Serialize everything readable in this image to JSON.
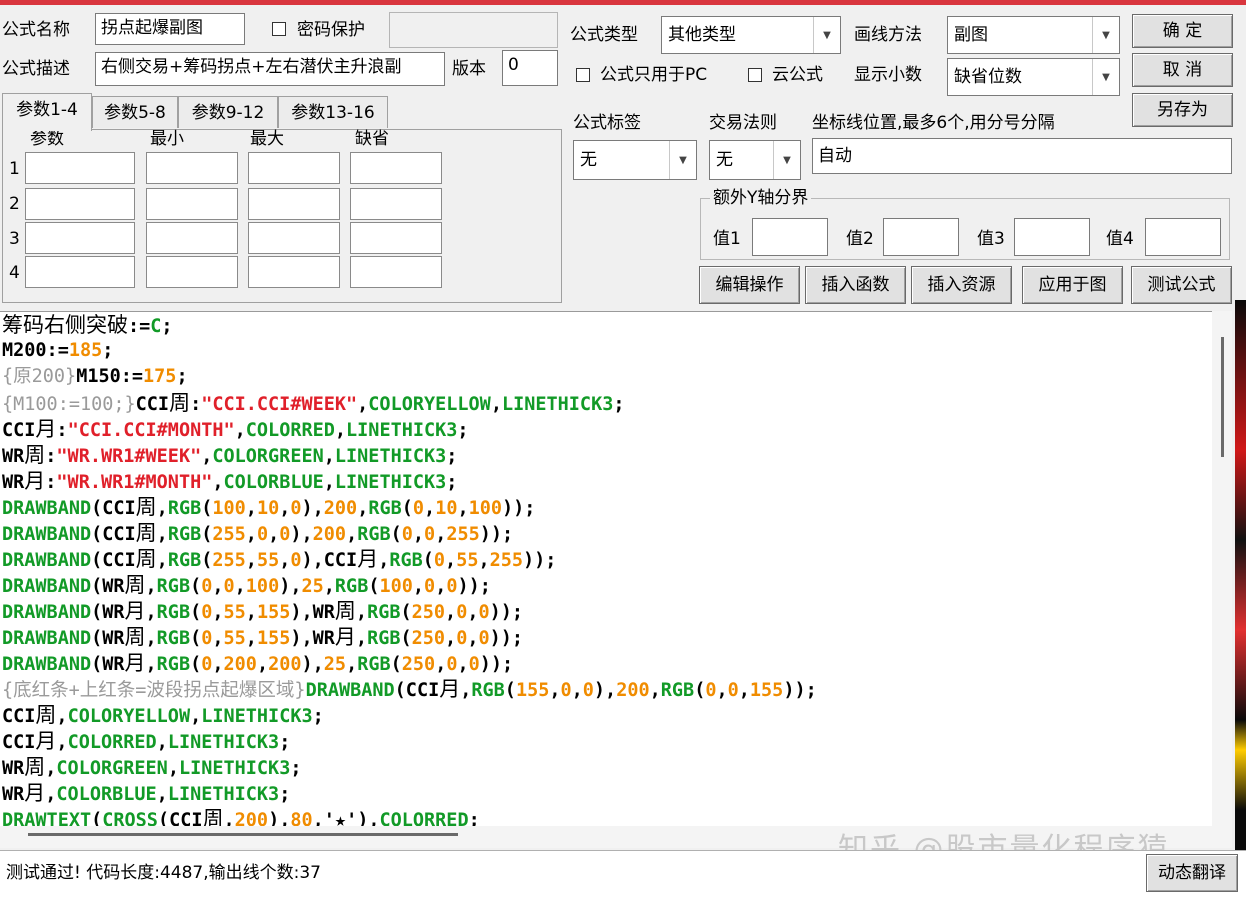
{
  "window": {
    "top_bar_color": "#d9363e"
  },
  "form": {
    "name_label": "公式名称",
    "name_value": "拐点起爆副图",
    "password_label": "密码保护",
    "desc_label": "公式描述",
    "desc_value": "右侧交易+筹码拐点+左右潜伏主升浪副",
    "version_label": "版本",
    "version_value": "0",
    "type_label": "公式类型",
    "type_value": "其他类型",
    "draw_label": "画线方法",
    "draw_value": "副图",
    "pc_only_label": "公式只用于PC",
    "cloud_label": "云公式",
    "decimals_label": "显示小数",
    "decimals_value": "缺省位数",
    "tag_label": "公式标签",
    "tag_value": "无",
    "rule_label": "交易法则",
    "rule_value": "无",
    "coord_label": "坐标线位置,最多6个,用分号分隔",
    "coord_value": "自动",
    "yaxis_group_label": "额外Y轴分界",
    "yaxis_values": [
      "值1",
      "值2",
      "值3",
      "值4"
    ]
  },
  "buttons": {
    "ok": "确  定",
    "cancel": "取  消",
    "save_as": "另存为",
    "edit": "编辑操作",
    "insert_func": "插入函数",
    "insert_res": "插入资源",
    "apply": "应用于图",
    "test": "测试公式",
    "dyn_translate": "动态翻译"
  },
  "params": {
    "tabs": [
      "参数1-4",
      "参数5-8",
      "参数9-12",
      "参数13-16"
    ],
    "headers": [
      "参数",
      "最小",
      "最大",
      "缺省"
    ],
    "rows": [
      "1",
      "2",
      "3",
      "4"
    ]
  },
  "code_lines": [
    [
      [
        "cn",
        "筹码右侧突破"
      ],
      [
        "k",
        ":="
      ],
      [
        "g",
        "C"
      ],
      [
        "k",
        ";"
      ]
    ],
    [
      [
        "k",
        "M200:="
      ],
      [
        "o",
        "185"
      ],
      [
        "k",
        ";"
      ]
    ],
    [
      [
        "gr",
        "{原200}"
      ],
      [
        "k",
        "M150:="
      ],
      [
        "o",
        "175"
      ],
      [
        "k",
        ";"
      ]
    ],
    [
      [
        "gr",
        "{M100:=100;}"
      ],
      [
        "k",
        "CCI"
      ],
      [
        "cnk",
        "周"
      ],
      [
        "k",
        ":"
      ],
      [
        "r",
        "\"CCI.CCI#WEEK\""
      ],
      [
        "k",
        ","
      ],
      [
        "g",
        "COLORYELLOW"
      ],
      [
        "k",
        ","
      ],
      [
        "g",
        "LINETHICK3"
      ],
      [
        "k",
        ";"
      ]
    ],
    [
      [
        "k",
        "CCI"
      ],
      [
        "cnk",
        "月"
      ],
      [
        "k",
        ":"
      ],
      [
        "r",
        "\"CCI.CCI#MONTH\""
      ],
      [
        "k",
        ","
      ],
      [
        "g",
        "COLORRED"
      ],
      [
        "k",
        ","
      ],
      [
        "g",
        "LINETHICK3"
      ],
      [
        "k",
        ";"
      ]
    ],
    [
      [
        "k",
        "WR"
      ],
      [
        "cnk",
        "周"
      ],
      [
        "k",
        ":"
      ],
      [
        "r",
        "\"WR.WR1#WEEK\""
      ],
      [
        "k",
        ","
      ],
      [
        "g",
        "COLORGREEN"
      ],
      [
        "k",
        ","
      ],
      [
        "g",
        "LINETHICK3"
      ],
      [
        "k",
        ";"
      ]
    ],
    [
      [
        "k",
        "WR"
      ],
      [
        "cnk",
        "月"
      ],
      [
        "k",
        ":"
      ],
      [
        "r",
        "\"WR.WR1#MONTH\""
      ],
      [
        "k",
        ","
      ],
      [
        "g",
        "COLORBLUE"
      ],
      [
        "k",
        ","
      ],
      [
        "g",
        "LINETHICK3"
      ],
      [
        "k",
        ";"
      ]
    ],
    [
      [
        "g",
        "DRAWBAND"
      ],
      [
        "k",
        "(CCI"
      ],
      [
        "cnk",
        "周"
      ],
      [
        "k",
        ","
      ],
      [
        "g",
        "RGB"
      ],
      [
        "k",
        "("
      ],
      [
        "o",
        "100"
      ],
      [
        "k",
        ","
      ],
      [
        "o",
        "10"
      ],
      [
        "k",
        ","
      ],
      [
        "o",
        "0"
      ],
      [
        "k",
        "),"
      ],
      [
        "o",
        "200"
      ],
      [
        "k",
        ","
      ],
      [
        "g",
        "RGB"
      ],
      [
        "k",
        "("
      ],
      [
        "o",
        "0"
      ],
      [
        "k",
        ","
      ],
      [
        "o",
        "10"
      ],
      [
        "k",
        ","
      ],
      [
        "o",
        "100"
      ],
      [
        "k",
        "));"
      ]
    ],
    [
      [
        "g",
        "DRAWBAND"
      ],
      [
        "k",
        "(CCI"
      ],
      [
        "cnk",
        "周"
      ],
      [
        "k",
        ","
      ],
      [
        "g",
        "RGB"
      ],
      [
        "k",
        "("
      ],
      [
        "o",
        "255"
      ],
      [
        "k",
        ","
      ],
      [
        "o",
        "0"
      ],
      [
        "k",
        ","
      ],
      [
        "o",
        "0"
      ],
      [
        "k",
        "),"
      ],
      [
        "o",
        "200"
      ],
      [
        "k",
        ","
      ],
      [
        "g",
        "RGB"
      ],
      [
        "k",
        "("
      ],
      [
        "o",
        "0"
      ],
      [
        "k",
        ","
      ],
      [
        "o",
        "0"
      ],
      [
        "k",
        ","
      ],
      [
        "o",
        "255"
      ],
      [
        "k",
        "));"
      ]
    ],
    [
      [
        "g",
        "DRAWBAND"
      ],
      [
        "k",
        "(CCI"
      ],
      [
        "cnk",
        "周"
      ],
      [
        "k",
        ","
      ],
      [
        "g",
        "RGB"
      ],
      [
        "k",
        "("
      ],
      [
        "o",
        "255"
      ],
      [
        "k",
        ","
      ],
      [
        "o",
        "55"
      ],
      [
        "k",
        ","
      ],
      [
        "o",
        "0"
      ],
      [
        "k",
        "),CCI"
      ],
      [
        "cnk",
        "月"
      ],
      [
        "k",
        ","
      ],
      [
        "g",
        "RGB"
      ],
      [
        "k",
        "("
      ],
      [
        "o",
        "0"
      ],
      [
        "k",
        ","
      ],
      [
        "o",
        "55"
      ],
      [
        "k",
        ","
      ],
      [
        "o",
        "255"
      ],
      [
        "k",
        "));"
      ]
    ],
    [
      [
        "g",
        "DRAWBAND"
      ],
      [
        "k",
        "(WR"
      ],
      [
        "cnk",
        "周"
      ],
      [
        "k",
        ","
      ],
      [
        "g",
        "RGB"
      ],
      [
        "k",
        "("
      ],
      [
        "o",
        "0"
      ],
      [
        "k",
        ","
      ],
      [
        "o",
        "0"
      ],
      [
        "k",
        ","
      ],
      [
        "o",
        "100"
      ],
      [
        "k",
        "),"
      ],
      [
        "o",
        "25"
      ],
      [
        "k",
        ","
      ],
      [
        "g",
        "RGB"
      ],
      [
        "k",
        "("
      ],
      [
        "o",
        "100"
      ],
      [
        "k",
        ","
      ],
      [
        "o",
        "0"
      ],
      [
        "k",
        ","
      ],
      [
        "o",
        "0"
      ],
      [
        "k",
        "));"
      ]
    ],
    [
      [
        "g",
        "DRAWBAND"
      ],
      [
        "k",
        "(WR"
      ],
      [
        "cnk",
        "月"
      ],
      [
        "k",
        ","
      ],
      [
        "g",
        "RGB"
      ],
      [
        "k",
        "("
      ],
      [
        "o",
        "0"
      ],
      [
        "k",
        ","
      ],
      [
        "o",
        "55"
      ],
      [
        "k",
        ","
      ],
      [
        "o",
        "155"
      ],
      [
        "k",
        "),WR"
      ],
      [
        "cnk",
        "周"
      ],
      [
        "k",
        ","
      ],
      [
        "g",
        "RGB"
      ],
      [
        "k",
        "("
      ],
      [
        "o",
        "250"
      ],
      [
        "k",
        ","
      ],
      [
        "o",
        "0"
      ],
      [
        "k",
        ","
      ],
      [
        "o",
        "0"
      ],
      [
        "k",
        "));"
      ]
    ],
    [
      [
        "g",
        "DRAWBAND"
      ],
      [
        "k",
        "(WR"
      ],
      [
        "cnk",
        "周"
      ],
      [
        "k",
        ","
      ],
      [
        "g",
        "RGB"
      ],
      [
        "k",
        "("
      ],
      [
        "o",
        "0"
      ],
      [
        "k",
        ","
      ],
      [
        "o",
        "55"
      ],
      [
        "k",
        ","
      ],
      [
        "o",
        "155"
      ],
      [
        "k",
        "),WR"
      ],
      [
        "cnk",
        "月"
      ],
      [
        "k",
        ","
      ],
      [
        "g",
        "RGB"
      ],
      [
        "k",
        "("
      ],
      [
        "o",
        "250"
      ],
      [
        "k",
        ","
      ],
      [
        "o",
        "0"
      ],
      [
        "k",
        ","
      ],
      [
        "o",
        "0"
      ],
      [
        "k",
        "));"
      ]
    ],
    [
      [
        "g",
        "DRAWBAND"
      ],
      [
        "k",
        "(WR"
      ],
      [
        "cnk",
        "月"
      ],
      [
        "k",
        ","
      ],
      [
        "g",
        "RGB"
      ],
      [
        "k",
        "("
      ],
      [
        "o",
        "0"
      ],
      [
        "k",
        ","
      ],
      [
        "o",
        "200"
      ],
      [
        "k",
        ","
      ],
      [
        "o",
        "200"
      ],
      [
        "k",
        "),"
      ],
      [
        "o",
        "25"
      ],
      [
        "k",
        ","
      ],
      [
        "g",
        "RGB"
      ],
      [
        "k",
        "("
      ],
      [
        "o",
        "250"
      ],
      [
        "k",
        ","
      ],
      [
        "o",
        "0"
      ],
      [
        "k",
        ","
      ],
      [
        "o",
        "0"
      ],
      [
        "k",
        "));"
      ]
    ],
    [
      [
        "gr",
        "{底红条+上红条=波段拐点起爆区域}"
      ],
      [
        "g",
        "DRAWBAND"
      ],
      [
        "k",
        "(CCI"
      ],
      [
        "cnk",
        "月"
      ],
      [
        "k",
        ","
      ],
      [
        "g",
        "RGB"
      ],
      [
        "k",
        "("
      ],
      [
        "o",
        "155"
      ],
      [
        "k",
        ","
      ],
      [
        "o",
        "0"
      ],
      [
        "k",
        ","
      ],
      [
        "o",
        "0"
      ],
      [
        "k",
        "),"
      ],
      [
        "o",
        "200"
      ],
      [
        "k",
        ","
      ],
      [
        "g",
        "RGB"
      ],
      [
        "k",
        "("
      ],
      [
        "o",
        "0"
      ],
      [
        "k",
        ","
      ],
      [
        "o",
        "0"
      ],
      [
        "k",
        ","
      ],
      [
        "o",
        "155"
      ],
      [
        "k",
        "));"
      ]
    ],
    [
      [
        "k",
        "CCI"
      ],
      [
        "cnk",
        "周"
      ],
      [
        "k",
        ","
      ],
      [
        "g",
        "COLORYELLOW"
      ],
      [
        "k",
        ","
      ],
      [
        "g",
        "LINETHICK3"
      ],
      [
        "k",
        ";"
      ]
    ],
    [
      [
        "k",
        "CCI"
      ],
      [
        "cnk",
        "月"
      ],
      [
        "k",
        ","
      ],
      [
        "g",
        "COLORRED"
      ],
      [
        "k",
        ","
      ],
      [
        "g",
        "LINETHICK3"
      ],
      [
        "k",
        ";"
      ]
    ],
    [
      [
        "k",
        "WR"
      ],
      [
        "cnk",
        "周"
      ],
      [
        "k",
        ","
      ],
      [
        "g",
        "COLORGREEN"
      ],
      [
        "k",
        ","
      ],
      [
        "g",
        "LINETHICK3"
      ],
      [
        "k",
        ";"
      ]
    ],
    [
      [
        "k",
        "WR"
      ],
      [
        "cnk",
        "月"
      ],
      [
        "k",
        ","
      ],
      [
        "g",
        "COLORBLUE"
      ],
      [
        "k",
        ","
      ],
      [
        "g",
        "LINETHICK3"
      ],
      [
        "k",
        ";"
      ]
    ],
    [
      [
        "g",
        "DRAWTEXT"
      ],
      [
        "k",
        "("
      ],
      [
        "g",
        "CROSS"
      ],
      [
        "k",
        "(CCI"
      ],
      [
        "cnk",
        "周"
      ],
      [
        "k",
        ","
      ],
      [
        "o",
        "200"
      ],
      [
        "k",
        "),"
      ],
      [
        "o",
        "80"
      ],
      [
        "k",
        ",'"
      ],
      [
        "k",
        "★"
      ],
      [
        "k",
        "'),"
      ],
      [
        "g",
        "COLORRED"
      ],
      [
        "k",
        ";"
      ]
    ]
  ],
  "status_text": "测试通过! 代码长度:4487,输出线个数:37",
  "watermark": "知乎 @股市量化程序猿"
}
